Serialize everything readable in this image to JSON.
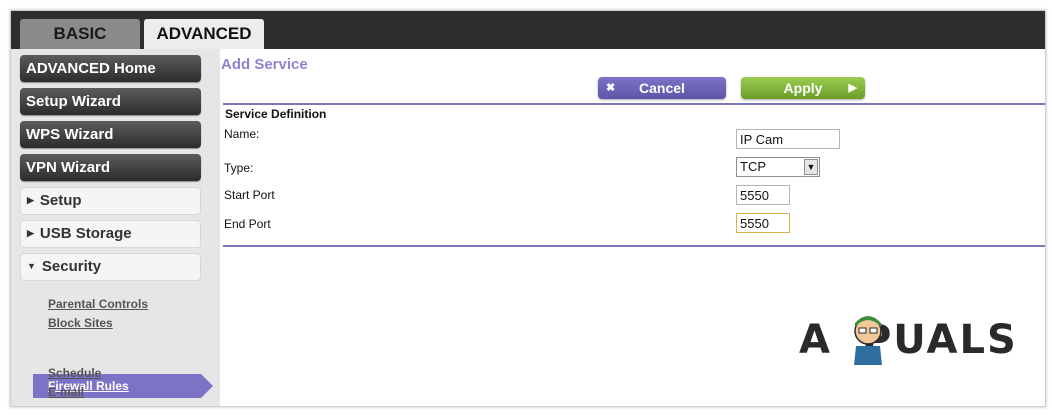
{
  "tabs": {
    "basic": "BASIC",
    "advanced": "ADVANCED"
  },
  "sidebar": {
    "nav": [
      "ADVANCED Home",
      "Setup Wizard",
      "WPS Wizard",
      "VPN Wizard"
    ],
    "sections": {
      "setup": "Setup",
      "usb": "USB Storage",
      "security": "Security"
    },
    "security_items": {
      "parental_controls": "Parental Controls",
      "block_sites": "Block Sites",
      "firewall_rules": "Firewall Rules",
      "schedule": "Schedule",
      "email": "E-mail"
    }
  },
  "main": {
    "title": "Add Service",
    "cancel_label": "Cancel",
    "apply_label": "Apply",
    "section_title": "Service Definition",
    "form": {
      "name_label": "Name:",
      "name_value": "IP Cam",
      "type_label": "Type:",
      "type_value": "TCP",
      "start_port_label": "Start Port",
      "start_port_value": "5550",
      "end_port_label": "End Port",
      "end_port_value": "5550"
    }
  },
  "watermark": {
    "left": "A",
    "right": "PUALS"
  },
  "colors": {
    "accent": "#7c73c7",
    "apply": "#8bbd45",
    "title": "#8b86cf"
  }
}
